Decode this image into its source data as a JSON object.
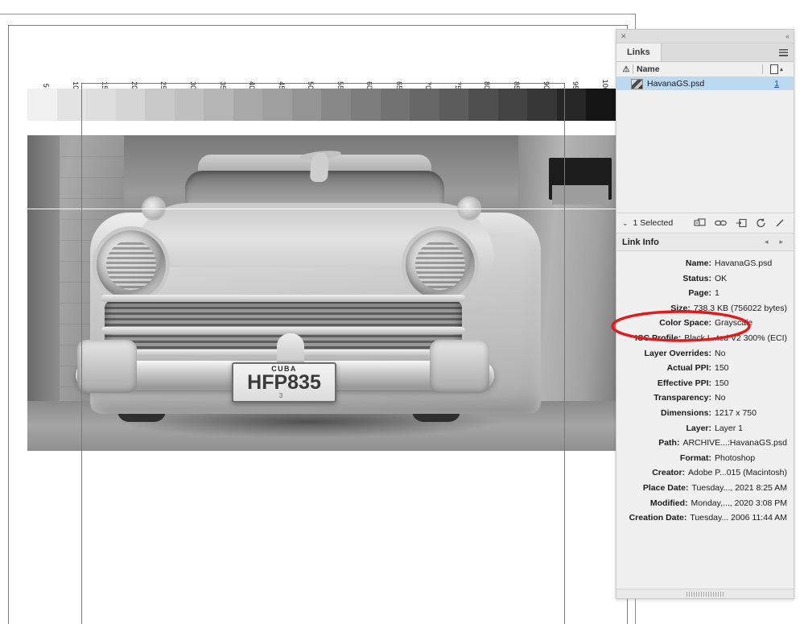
{
  "document": {
    "wedge": {
      "labels": [
        "5 k",
        "10 k",
        "15 k",
        "20 k",
        "25 k",
        "30 k",
        "35 k",
        "40 k",
        "45 k",
        "50 k",
        "55 k",
        "60 k",
        "65 k",
        "70 k",
        "75 k",
        "80 k",
        "85 k",
        "90 k",
        "95 k",
        "100 k"
      ],
      "tones": [
        "#f1f1f1",
        "#e3e3e3",
        "#dedede",
        "#d5d5d5",
        "#c9c9c9",
        "#bfbfbf",
        "#b5b5b5",
        "#a9a9a9",
        "#9f9f9f",
        "#949494",
        "#888888",
        "#7d7d7d",
        "#727272",
        "#676767",
        "#5c5c5c",
        "#4f4f4f",
        "#434343",
        "#373737",
        "#262626",
        "#141414"
      ]
    },
    "photo": {
      "alt": "Grayscale photo of a vintage American car in a Havana street",
      "license_plate": {
        "country": "CUBA",
        "number": "HFP835",
        "sub": "3"
      }
    },
    "guides": {
      "margin_color": "#cc33ff",
      "bleed_color": "#f1607a",
      "page_color": "#7a7a7a"
    }
  },
  "panel": {
    "close_label": "✕",
    "collapse_label": "«",
    "tab_label": "Links",
    "menu_label": "≡",
    "columns": {
      "warn": "⚠",
      "name": "Name",
      "sort_arrow": "▴"
    },
    "rows": [
      {
        "name": "HavanaGS.psd",
        "page": "1"
      }
    ],
    "selection": {
      "chevron": "⌄",
      "label": "1 Selected"
    },
    "link_info": {
      "title": "Link Info",
      "prev": "◂",
      "next": "▸",
      "fields": [
        {
          "key": "Name:",
          "value": "HavanaGS.psd"
        },
        {
          "key": "Status:",
          "value": "OK"
        },
        {
          "key": "Page:",
          "value": "1"
        },
        {
          "key": "Size:",
          "value": "738.3 KB (756022 bytes)"
        },
        {
          "key": "Color Space:",
          "value": "Grayscale"
        },
        {
          "key": "ICC Profile:",
          "value": "Black I...ted V2 300% (ECI)"
        },
        {
          "key": "Layer Overrides:",
          "value": "No"
        },
        {
          "key": "Actual PPI:",
          "value": "150"
        },
        {
          "key": "Effective PPI:",
          "value": "150"
        },
        {
          "key": "Transparency:",
          "value": "No"
        },
        {
          "key": "Dimensions:",
          "value": "1217 x 750"
        },
        {
          "key": "Layer:",
          "value": "Layer 1"
        },
        {
          "key": "Path:",
          "value": "ARCHIVE...:HavanaGS.psd"
        },
        {
          "key": "Format:",
          "value": "Photoshop"
        },
        {
          "key": "Creator:",
          "value": "Adobe P...015 (Macintosh)"
        },
        {
          "key": "Place Date:",
          "value": "Tuesday..., 2021 8:25 AM"
        },
        {
          "key": "Modified:",
          "value": "Monday,..., 2020 3:08 PM"
        },
        {
          "key": "Creation Date:",
          "value": "Tuesday... 2006 11:44 AM"
        }
      ]
    }
  },
  "annotation": {
    "type": "ellipse",
    "color": "#e11b1b",
    "targets": "Color Space: Grayscale"
  }
}
